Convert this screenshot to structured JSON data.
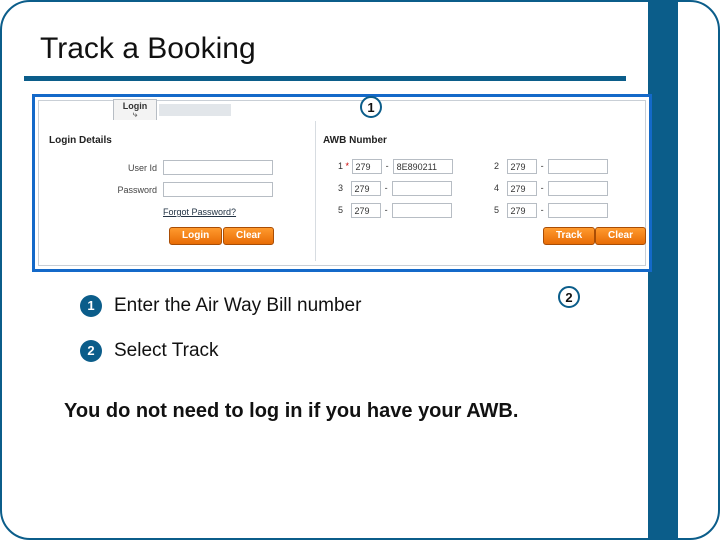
{
  "title": "Track a Booking",
  "panel": {
    "login_tab": "Login",
    "login_sub": "⤷",
    "login_details": "Login Details",
    "awb_heading": "AWB Number",
    "userid_label": "User Id",
    "password_label": "Password",
    "forgot": "Forgot Password?",
    "login_btn": "Login",
    "clear_btn": "Clear",
    "track_btn": "Track",
    "awb": {
      "rows": [
        {
          "n": "1",
          "star": true,
          "prefix": "279",
          "serial": "8E890211"
        },
        {
          "n": "2",
          "star": false,
          "prefix": "279",
          "serial": ""
        },
        {
          "n": "3",
          "star": false,
          "prefix": "279",
          "serial": ""
        },
        {
          "n": "4",
          "star": false,
          "prefix": "279",
          "serial": ""
        },
        {
          "n": "5",
          "star": false,
          "prefix": "279",
          "serial": ""
        },
        {
          "n": "5",
          "star": false,
          "prefix": "279",
          "serial": ""
        }
      ]
    }
  },
  "callouts": {
    "c1": "1",
    "c2": "2"
  },
  "steps": {
    "b1": "1",
    "t1": "Enter the Air Way Bill number",
    "b2": "2",
    "t2": "Select Track"
  },
  "note": "You do not need to log in if you have your AWB."
}
